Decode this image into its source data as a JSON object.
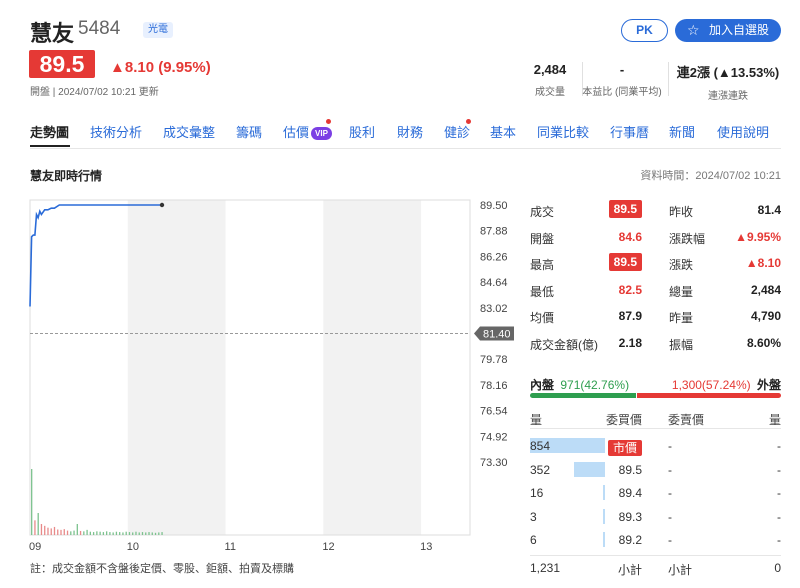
{
  "stock": {
    "name": "慧友",
    "code": "5484",
    "industry": "光電",
    "price": "89.5",
    "change": "▲8.10 (9.95%)",
    "meta": "開盤 | 2024/07/02 10:21 更新"
  },
  "actions": {
    "pk_label": "PK",
    "add_label": "加入自選股",
    "star_icon": "star-outline-icon"
  },
  "stats": [
    {
      "value": "2,484",
      "label": "成交量"
    },
    {
      "value": "-",
      "label": "本益比 (同業平均)"
    },
    {
      "value": "連2漲 (▲13.53%)",
      "label": "連漲連跌"
    }
  ],
  "tabs": [
    "走勢圖",
    "技術分析",
    "成交彙整",
    "籌碼",
    "估價",
    "股利",
    "財務",
    "健診",
    "基本",
    "同業比較",
    "行事曆",
    "新聞",
    "使用說明"
  ],
  "vip_label": "VIP",
  "section": {
    "title": "慧友即時行情",
    "data_time": "資料時間：2024/07/02 10:21"
  },
  "chart_data": {
    "type": "line",
    "x_ticks": [
      "09",
      "10",
      "11",
      "12",
      "13"
    ],
    "y_ticks": [
      "89.50",
      "87.88",
      "86.26",
      "84.64",
      "83.02",
      "81.40",
      "79.78",
      "78.16",
      "76.54",
      "74.92",
      "73.30"
    ],
    "reference_price": "81.40",
    "ylim": [
      73.3,
      89.5
    ],
    "price_series": [
      {
        "t": 0,
        "p": 83.1
      },
      {
        "t": 1,
        "p": 87.5
      },
      {
        "t": 2,
        "p": 87.6
      },
      {
        "t": 3,
        "p": 87.6
      },
      {
        "t": 4,
        "p": 88.9
      },
      {
        "t": 5,
        "p": 88.7
      },
      {
        "t": 6,
        "p": 89.1
      },
      {
        "t": 7,
        "p": 88.9
      },
      {
        "t": 9,
        "p": 89.2
      },
      {
        "t": 11,
        "p": 89.2
      },
      {
        "t": 13,
        "p": 89.3
      },
      {
        "t": 15,
        "p": 89.3
      },
      {
        "t": 18,
        "p": 89.5
      },
      {
        "t": 25,
        "p": 89.5
      },
      {
        "t": 40,
        "p": 89.5
      },
      {
        "t": 60,
        "p": 89.5
      },
      {
        "t": 81,
        "p": 89.5
      }
    ],
    "volume_bars": [
      {
        "t": 1,
        "v": 180,
        "c": "g"
      },
      {
        "t": 3,
        "v": 40,
        "c": "r"
      },
      {
        "t": 5,
        "v": 60,
        "c": "g"
      },
      {
        "t": 7,
        "v": 30,
        "c": "r"
      },
      {
        "t": 9,
        "v": 25,
        "c": "r"
      },
      {
        "t": 11,
        "v": 20,
        "c": "r"
      },
      {
        "t": 13,
        "v": 18,
        "c": "r"
      },
      {
        "t": 15,
        "v": 22,
        "c": "r"
      },
      {
        "t": 17,
        "v": 15,
        "c": "r"
      },
      {
        "t": 19,
        "v": 14,
        "c": "r"
      },
      {
        "t": 21,
        "v": 16,
        "c": "r"
      },
      {
        "t": 23,
        "v": 12,
        "c": "r"
      },
      {
        "t": 25,
        "v": 10,
        "c": "g"
      },
      {
        "t": 27,
        "v": 12,
        "c": "g"
      },
      {
        "t": 29,
        "v": 30,
        "c": "g"
      },
      {
        "t": 31,
        "v": 11,
        "c": "r"
      },
      {
        "t": 33,
        "v": 10,
        "c": "g"
      },
      {
        "t": 35,
        "v": 14,
        "c": "g"
      },
      {
        "t": 37,
        "v": 9,
        "c": "g"
      },
      {
        "t": 39,
        "v": 8,
        "c": "g"
      },
      {
        "t": 41,
        "v": 10,
        "c": "g"
      },
      {
        "t": 43,
        "v": 9,
        "c": "g"
      },
      {
        "t": 45,
        "v": 8,
        "c": "g"
      },
      {
        "t": 47,
        "v": 10,
        "c": "g"
      },
      {
        "t": 49,
        "v": 8,
        "c": "g"
      },
      {
        "t": 51,
        "v": 7,
        "c": "g"
      },
      {
        "t": 53,
        "v": 9,
        "c": "g"
      },
      {
        "t": 55,
        "v": 8,
        "c": "g"
      },
      {
        "t": 57,
        "v": 7,
        "c": "g"
      },
      {
        "t": 59,
        "v": 9,
        "c": "g"
      },
      {
        "t": 61,
        "v": 8,
        "c": "g"
      },
      {
        "t": 63,
        "v": 7,
        "c": "g"
      },
      {
        "t": 65,
        "v": 9,
        "c": "g"
      },
      {
        "t": 67,
        "v": 7,
        "c": "g"
      },
      {
        "t": 69,
        "v": 8,
        "c": "g"
      },
      {
        "t": 71,
        "v": 7,
        "c": "g"
      },
      {
        "t": 73,
        "v": 8,
        "c": "g"
      },
      {
        "t": 75,
        "v": 7,
        "c": "g"
      },
      {
        "t": 77,
        "v": 6,
        "c": "g"
      },
      {
        "t": 79,
        "v": 7,
        "c": "g"
      },
      {
        "t": 81,
        "v": 8,
        "c": "g"
      }
    ]
  },
  "quote_left": [
    {
      "label": "成交",
      "value": "89.5",
      "style": "boxed"
    },
    {
      "label": "開盤",
      "value": "84.6",
      "style": "red"
    },
    {
      "label": "最高",
      "value": "89.5",
      "style": "boxed"
    },
    {
      "label": "最低",
      "value": "82.5",
      "style": "red"
    },
    {
      "label": "均價",
      "value": "87.9",
      "style": "plain"
    },
    {
      "label": "成交金額(億)",
      "value": "2.18",
      "style": "plain"
    }
  ],
  "quote_right": [
    {
      "label": "昨收",
      "value": "81.4",
      "style": "plain"
    },
    {
      "label": "漲跌幅",
      "value": "▲9.95%",
      "style": "red"
    },
    {
      "label": "漲跌",
      "value": "▲8.10",
      "style": "red"
    },
    {
      "label": "總量",
      "value": "2,484",
      "style": "plain"
    },
    {
      "label": "昨量",
      "value": "4,790",
      "style": "plain"
    },
    {
      "label": "振幅",
      "value": "8.60%",
      "style": "plain"
    }
  ],
  "inner_outer": {
    "inner_label": "內盤",
    "inner_value": "971(42.76%)",
    "outer_value": "1,300(57.24%)",
    "outer_label": "外盤",
    "inner_ratio": 0.4276
  },
  "orderbook": {
    "headers": [
      "量",
      "委買價",
      "委賣價",
      "量"
    ],
    "rows": [
      {
        "bid_vol": "854",
        "bid": "市價",
        "ask": "-",
        "ask_vol": "-",
        "bar": 1.0
      },
      {
        "bid_vol": "352",
        "bid": "89.5",
        "ask": "-",
        "ask_vol": "-",
        "bar": 0.41
      },
      {
        "bid_vol": "16",
        "bid": "89.4",
        "ask": "-",
        "ask_vol": "-",
        "bar": 0.02
      },
      {
        "bid_vol": "3",
        "bid": "89.3",
        "ask": "-",
        "ask_vol": "-",
        "bar": 0.01
      },
      {
        "bid_vol": "6",
        "bid": "89.2",
        "ask": "-",
        "ask_vol": "-",
        "bar": 0.01
      }
    ],
    "footer": {
      "bid_total": "1,231",
      "bid_label": "小計",
      "ask_label": "小計",
      "ask_total": "0"
    }
  },
  "footnote": "註：成交金額不含盤後定價、零股、鉅額、拍賣及標購"
}
